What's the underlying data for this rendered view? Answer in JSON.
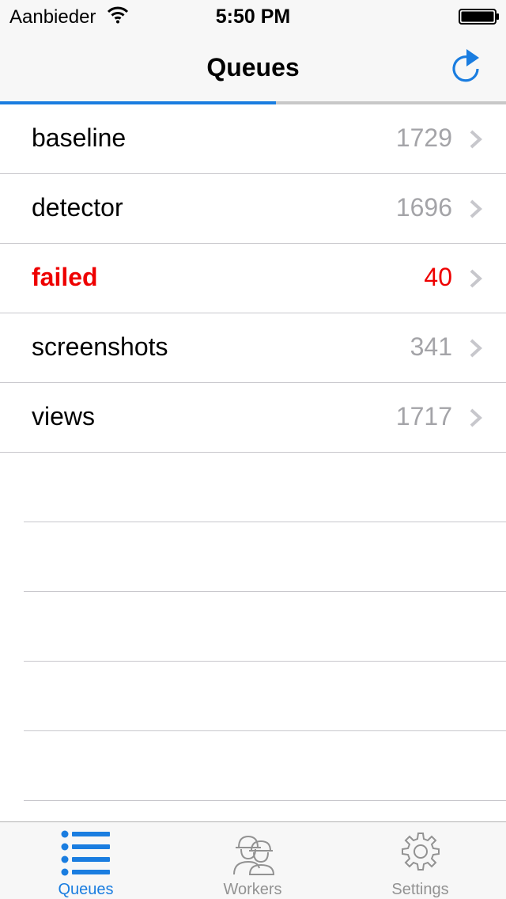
{
  "status_bar": {
    "carrier": "Aanbieder",
    "time": "5:50 PM"
  },
  "nav": {
    "title": "Queues",
    "refresh_icon": "refresh-icon",
    "progress_fraction": 0.545
  },
  "queues": [
    {
      "name": "baseline",
      "count": "1729",
      "status": "normal"
    },
    {
      "name": "detector",
      "count": "1696",
      "status": "normal"
    },
    {
      "name": "failed",
      "count": "40",
      "status": "error"
    },
    {
      "name": "screenshots",
      "count": "341",
      "status": "normal"
    },
    {
      "name": "views",
      "count": "1717",
      "status": "normal"
    }
  ],
  "tab_bar": {
    "tabs": [
      {
        "label": "Queues",
        "icon": "list-icon",
        "active": true
      },
      {
        "label": "Workers",
        "icon": "workers-icon",
        "active": false
      },
      {
        "label": "Settings",
        "icon": "gear-icon",
        "active": false
      }
    ]
  },
  "colors": {
    "accent": "#1a7de0",
    "error": "#ee0000",
    "muted": "#a4a4a8"
  }
}
